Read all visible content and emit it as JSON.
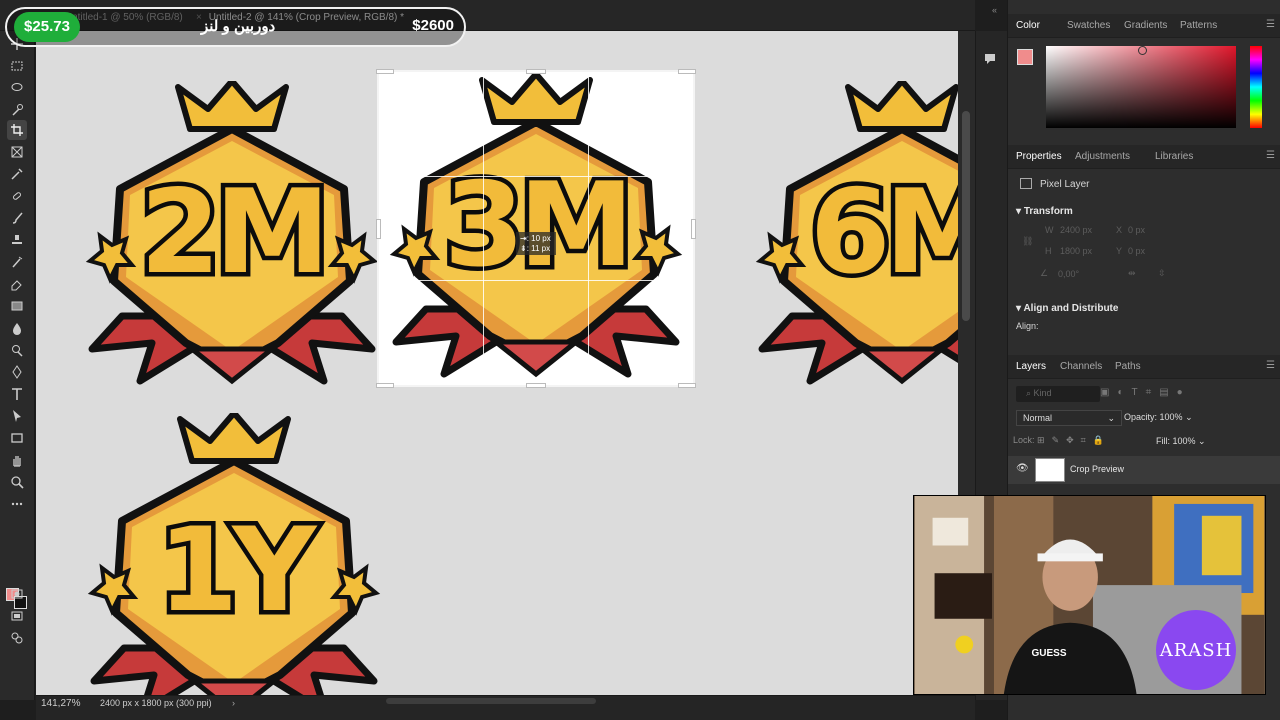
{
  "document_tabs": [
    {
      "title": "Untitled-1 @ 50% (RGB/8)"
    },
    {
      "title": "Untitled-2 @ 141% (Crop Preview, RGB/8) *"
    }
  ],
  "donation_overlay": {
    "amount": "$25.73",
    "name": "دوربین و لنز",
    "total": "$2600"
  },
  "badges": [
    {
      "label": "2M"
    },
    {
      "label": "3M"
    },
    {
      "label": "6M"
    },
    {
      "label": "1Y"
    }
  ],
  "crop_tooltip": {
    "line1": "⇥: 10 px",
    "line2": "⇟: 11 px"
  },
  "status_bar": {
    "zoom": "141,27%",
    "doc_info": "2400 px x 1800 px (300 ppi)",
    "arrow": "›"
  },
  "color_panel": {
    "tabs": [
      "Color",
      "Swatches",
      "Gradients",
      "Patterns"
    ],
    "foreground": "#f08c8c"
  },
  "properties_panel": {
    "tabs": [
      "Properties",
      "Adjustments",
      "Libraries"
    ],
    "layer_type": "Pixel Layer",
    "transform_title": "Transform",
    "w_label": "W",
    "w_value": "2400 px",
    "x_label": "X",
    "x_value": "0 px",
    "h_label": "H",
    "h_value": "1800 px",
    "y_label": "Y",
    "y_value": "0 px",
    "angle_value": "0,00°",
    "align_title": "Align and Distribute",
    "align_label": "Align:"
  },
  "layers_panel": {
    "tabs": [
      "Layers",
      "Channels",
      "Paths"
    ],
    "kind_placeholder": "Kind",
    "blend_mode": "Normal",
    "opacity_label": "Opacity:",
    "opacity_value": "100%",
    "lock_label": "Lock:",
    "fill_label": "Fill:",
    "fill_value": "100%",
    "layer_name": "Crop Preview"
  },
  "webcam": {
    "logo_text": "ARASH",
    "shirt_text": "GUESS"
  }
}
